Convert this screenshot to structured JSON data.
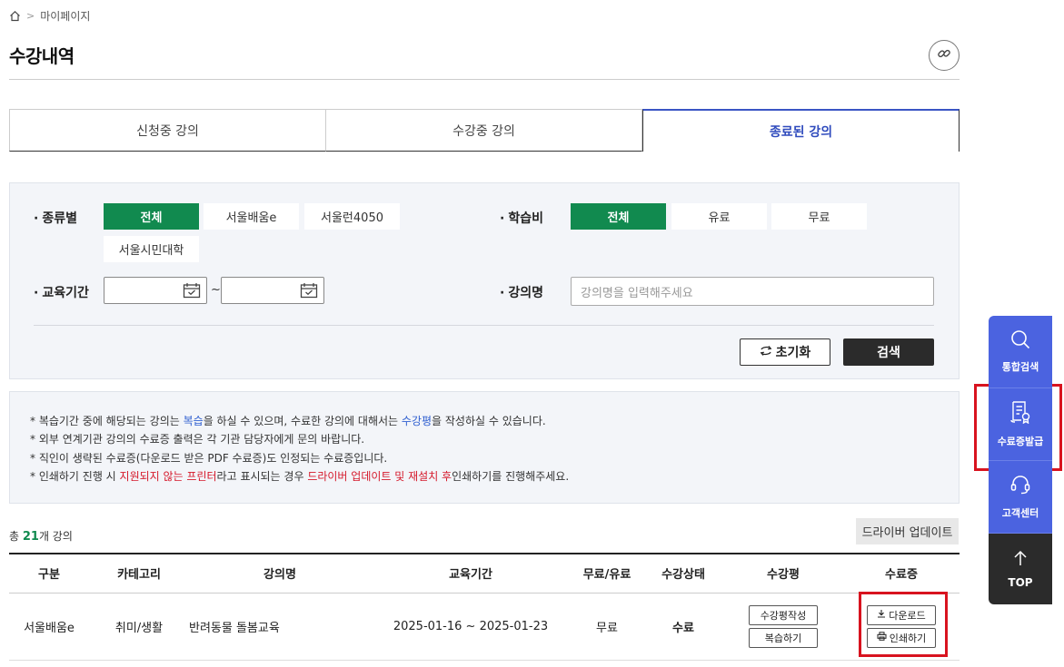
{
  "breadcrumb": {
    "current": "마이페이지"
  },
  "page": {
    "title": "수강내역"
  },
  "tabs": [
    {
      "label": "신청중 강의"
    },
    {
      "label": "수강중 강의"
    },
    {
      "label": "종료된 강의",
      "active": true
    }
  ],
  "filters": {
    "type_label": "종류별",
    "type_options": [
      "전체",
      "서울배움e",
      "서울런4050",
      "서울시민대학"
    ],
    "type_selected": "전체",
    "fee_label": "학습비",
    "fee_options": [
      "전체",
      "유료",
      "무료"
    ],
    "fee_selected": "전체",
    "period_label": "교육기간",
    "period_start": "",
    "period_end": "",
    "period_separator": "~",
    "name_label": "강의명",
    "name_placeholder": "강의명을 입력해주세요",
    "reset_label": "초기화",
    "search_label": "검색"
  },
  "notice": {
    "line1": {
      "a": "* 복습기간 중에 해당되는 강의는 ",
      "b": "복습",
      "c": "을 하실 수 있으며, 수료한 강의에 대해서는 ",
      "d": "수강평",
      "e": "을 작성하실 수 있습니다."
    },
    "line2": "* 외부 연계기관 강의의 수료증 출력은 각 기관 담당자에게 문의 바랍니다.",
    "line3": "* 직인이 생략된 수료증(다운로드 받은 PDF 수료증)도 인정되는 수료증입니다.",
    "line4": {
      "a": "* 인쇄하기 진행 시 ",
      "b": "지원되지 않는 프린터",
      "c": "라고 표시되는 경우 ",
      "d": "드라이버 업데이트 및 재설치 후",
      "e": "인쇄하기를 진행해주세요."
    }
  },
  "list": {
    "total_prefix": "총 ",
    "total_count": "21",
    "total_suffix": "개 강의",
    "driver_update_label": "드라이버 업데이트",
    "columns": [
      "구분",
      "카테고리",
      "강의명",
      "교육기간",
      "무료/유료",
      "수강상태",
      "수강평",
      "수료증"
    ],
    "rows": [
      {
        "division": "서울배움e",
        "category": "취미/생활",
        "name": "반려동물 돌봄교육",
        "period": "2025-01-16 ~ 2025-01-23",
        "fee": "무료",
        "status": "수료",
        "review_write": "수강평작성",
        "review_repeat": "복습하기",
        "cert_download": "다운로드",
        "cert_print": "인쇄하기"
      }
    ]
  },
  "side_menu": {
    "search": "통합검색",
    "certificate": "수료증발급",
    "support": "고객센터",
    "top": "TOP"
  },
  "colors": {
    "accent_green": "#118a4f",
    "accent_blue": "#4b63e0",
    "highlight_red": "#d8131f"
  }
}
